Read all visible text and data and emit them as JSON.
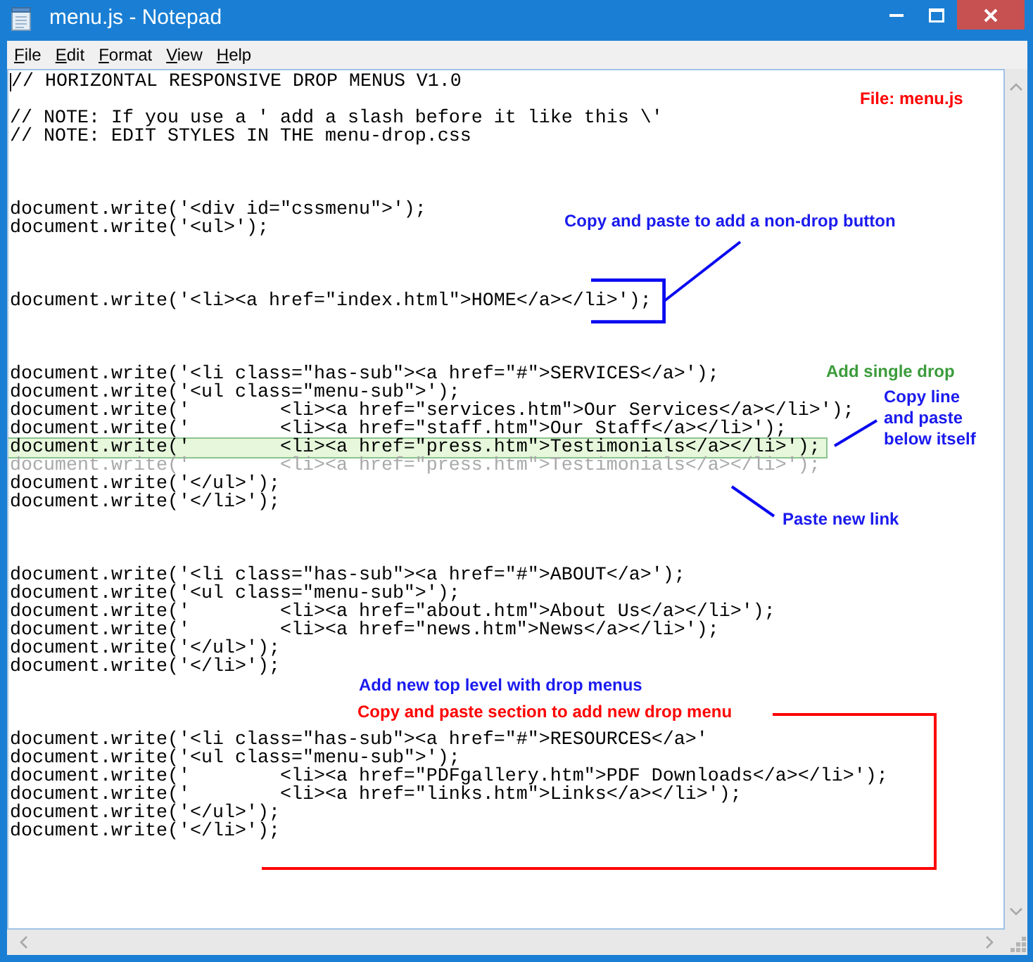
{
  "window": {
    "title": "menu.js - Notepad"
  },
  "menu": [
    "File",
    "Edit",
    "Format",
    "View",
    "Help"
  ],
  "editor": {
    "header": {
      "title": "// HORIZONTAL RESPONSIVE DROP MENUS V1.0",
      "notes": [
        "// NOTE: If you use a ' add a slash before it like this \\'",
        "// NOTE: EDIT STYLES IN THE menu-drop.css"
      ]
    },
    "blocks": [
      {
        "lines": [
          {
            "text": "document.write('<div id=\"cssmenu\">');",
            "kind": "plain"
          },
          {
            "text": "document.write('<ul>');",
            "kind": "plain"
          }
        ]
      },
      {
        "lines": [
          {
            "text": "document.write('<li><a href=\"index.html\">HOME</a></li>');",
            "kind": "plain"
          }
        ]
      },
      {
        "lines": [
          {
            "text": "document.write('<li class=\"has-sub\"><a href=\"#\">SERVICES</a>');",
            "kind": "plain"
          },
          {
            "text": "document.write('<ul class=\"menu-sub\">');",
            "kind": "plain"
          },
          {
            "text": "document.write('        <li><a href=\"services.htm\">Our Services</a></li>');",
            "kind": "plain"
          },
          {
            "text": "document.write('        <li><a href=\"staff.htm\">Our Staff</a></li>');",
            "kind": "plain"
          },
          {
            "text": "document.write('        <li><a href=\"press.htm\">Testimonials</a></li>');",
            "kind": "highlight"
          },
          {
            "text": "document.write('        <li><a href=\"press.htm\">Testimonials</a></li>');",
            "kind": "ghost"
          },
          {
            "text": "document.write('</ul>');",
            "kind": "plain"
          },
          {
            "text": "document.write('</li>');",
            "kind": "plain"
          }
        ]
      },
      {
        "lines": [
          {
            "text": "document.write('<li class=\"has-sub\"><a href=\"#\">ABOUT</a>');",
            "kind": "plain"
          },
          {
            "text": "document.write('<ul class=\"menu-sub\">');",
            "kind": "plain"
          },
          {
            "text": "document.write('        <li><a href=\"about.htm\">About Us</a></li>');",
            "kind": "plain"
          },
          {
            "text": "document.write('        <li><a href=\"news.htm\">News</a></li>');",
            "kind": "plain"
          },
          {
            "text": "document.write('</ul>');",
            "kind": "plain"
          },
          {
            "text": "document.write('</li>');",
            "kind": "plain"
          }
        ]
      },
      {
        "lines": [
          {
            "text": "document.write('<li class=\"has-sub\"><a href=\"#\">RESOURCES</a>'",
            "kind": "plain"
          },
          {
            "text": "document.write('<ul class=\"menu-sub\">');",
            "kind": "plain"
          },
          {
            "text": "document.write('        <li><a href=\"PDFgallery.htm\">PDF Downloads</a></li>');",
            "kind": "plain"
          },
          {
            "text": "document.write('        <li><a href=\"links.htm\">Links</a></li>');",
            "kind": "plain"
          },
          {
            "text": "document.write('</ul>');",
            "kind": "plain"
          },
          {
            "text": "document.write('</li>');",
            "kind": "plain"
          }
        ]
      }
    ]
  },
  "annotations": [
    {
      "text": "File: menu.js",
      "color": "#ff0000"
    },
    {
      "text": "Copy and paste to add a non-drop button",
      "color": "#1a1aee"
    },
    {
      "text": "Add single drop",
      "color": "#3c9c3c"
    },
    {
      "text": "Copy line and paste below itself",
      "color": "#1a1aee"
    },
    {
      "text": "Paste new link",
      "color": "#1a1aee"
    },
    {
      "text": "Add new top level with drop menus",
      "color": "#1a1aee"
    },
    {
      "text": "Copy and paste section to add new drop menu",
      "color": "#ff0000"
    }
  ]
}
